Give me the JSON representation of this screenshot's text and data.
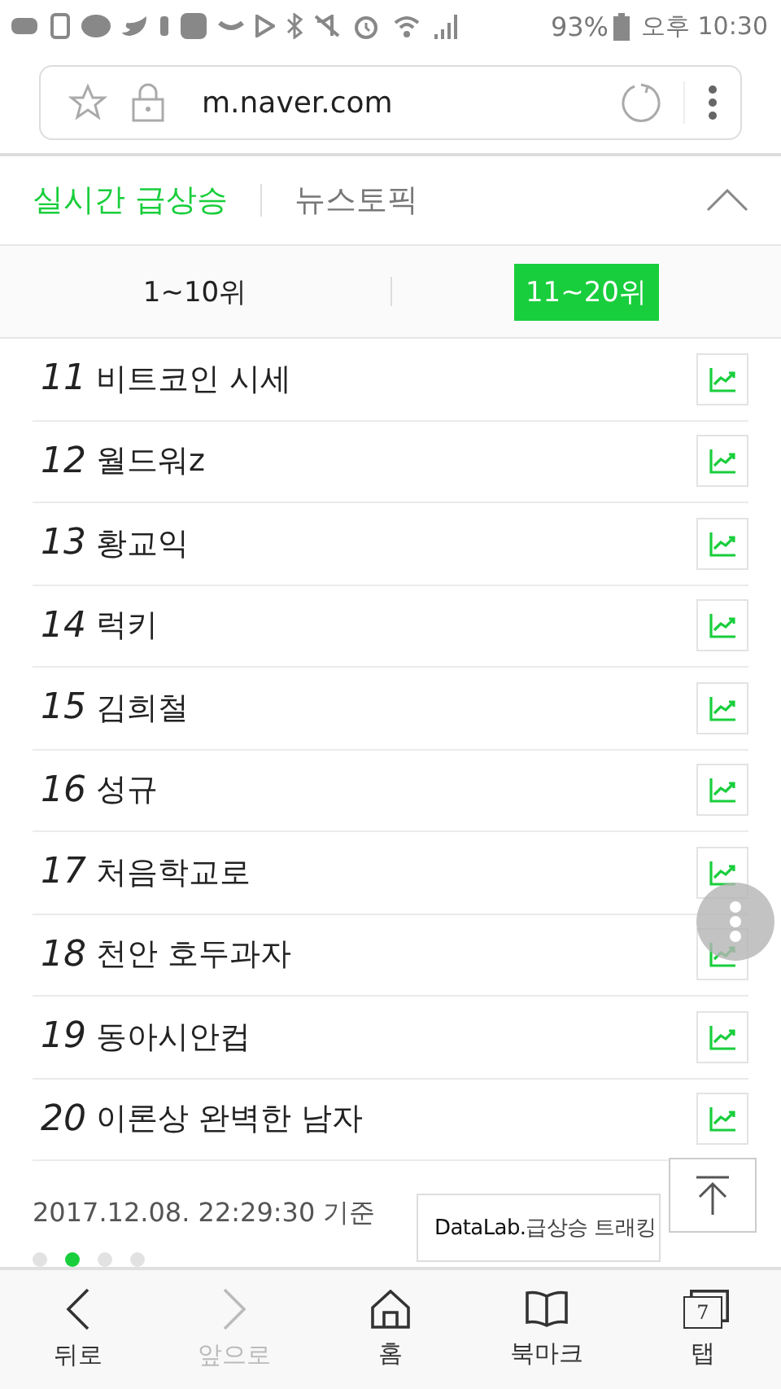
{
  "status_bar": {
    "battery": "93%",
    "time": "오후 10:30"
  },
  "address_bar": {
    "url": "m.naver.com"
  },
  "section_tabs": [
    {
      "label": "실시간 급상승",
      "selected": true
    },
    {
      "label": "뉴스토픽",
      "selected": false
    }
  ],
  "rank_tabs": [
    {
      "label": "1~10위",
      "selected": false
    },
    {
      "label": "11~20위",
      "selected": true
    }
  ],
  "rows": [
    {
      "rank": "11",
      "keyword": "비트코인 시세"
    },
    {
      "rank": "12",
      "keyword": "월드워z"
    },
    {
      "rank": "13",
      "keyword": "황교익"
    },
    {
      "rank": "14",
      "keyword": "럭키"
    },
    {
      "rank": "15",
      "keyword": "김희철"
    },
    {
      "rank": "16",
      "keyword": "성규"
    },
    {
      "rank": "17",
      "keyword": "처음학교로"
    },
    {
      "rank": "18",
      "keyword": "천안 호두과자"
    },
    {
      "rank": "19",
      "keyword": "동아시안컵"
    },
    {
      "rank": "20",
      "keyword": "이론상 완벽한 남자"
    }
  ],
  "footer": {
    "timestamp": "2017.12.08. 22:29:30 기준",
    "datalab_brand": "DataLab.",
    "datalab_label": "급상승 트래킹"
  },
  "pager": [
    {
      "selected": false
    },
    {
      "selected": true
    },
    {
      "selected": false
    },
    {
      "selected": false
    }
  ],
  "bottom_nav": [
    {
      "kind": "back",
      "label": "뒤로",
      "disabled": false
    },
    {
      "kind": "forward",
      "label": "앞으로",
      "disabled": true
    },
    {
      "kind": "home",
      "label": "홈",
      "disabled": false
    },
    {
      "kind": "bookmark",
      "label": "북마크",
      "disabled": false
    },
    {
      "kind": "tabs",
      "label": "탭",
      "disabled": false,
      "count": "7"
    }
  ]
}
